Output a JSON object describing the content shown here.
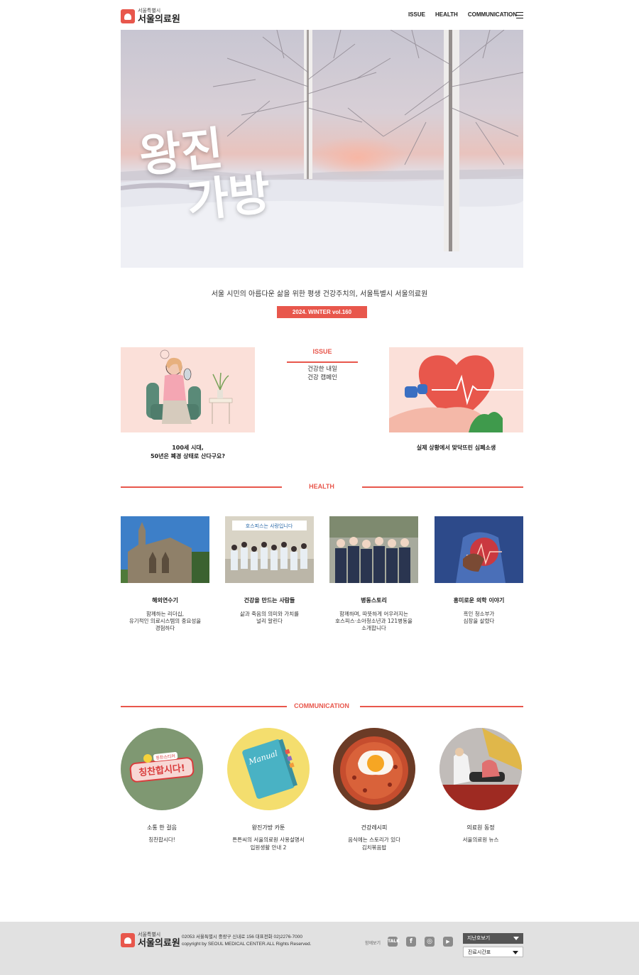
{
  "header": {
    "logo_small": "서울특별시",
    "logo_big": "서울의료원",
    "logo_badge": "서울특별시",
    "nav": [
      "ISSUE",
      "HEALTH",
      "COMMUNICATION"
    ]
  },
  "hero": {
    "title_line1": "왕진",
    "title_line2": "가방"
  },
  "intro": {
    "tagline": "서울 시민의 아름다운 삶을 위한 평생 건강주치의, 서울특별시 서울의료원",
    "volume": "2024. WINTER vol.160"
  },
  "issue": {
    "heading": "ISSUE",
    "sub_line1": "건강한 내일",
    "sub_line2": "건강 캠페인",
    "left_caption_line1": "100세 시대,",
    "left_caption_line2": "50년은 폐경 상태로 산다구요?",
    "right_caption": "실제 상황에서 맞닥뜨린 심폐소생"
  },
  "health": {
    "heading": "HEALTH",
    "items": [
      {
        "title": "해외연수기",
        "desc1": "함께하는 리더십,",
        "desc2": "유기적인 의료시스템의 중요성을",
        "desc3": "경험하다"
      },
      {
        "title": "건강을 만드는 사람들",
        "desc1": "삶과 죽음의 의미와 가치를",
        "desc2": "널리 알린다",
        "desc3": "",
        "banner": "호스피스는 사랑입니다"
      },
      {
        "title": "병동스토리",
        "desc1": "함께하며, 따뜻하게 어우러지는",
        "desc2": "호스피스·소아청소년과 121병동을",
        "desc3": "소개합니다"
      },
      {
        "title": "흥미로운 의학 이야기",
        "desc1": "흑인 청소부가",
        "desc2": "심장을 살렸다",
        "desc3": ""
      }
    ]
  },
  "communication": {
    "heading": "COMMUNICATION",
    "sticker_top": "칭찬스티커",
    "sticker_main": "칭찬합시다!",
    "manual_text": "Manual",
    "items": [
      {
        "title": "소통 한 걸음",
        "desc1": "칭찬합시다!",
        "desc2": ""
      },
      {
        "title": "왕진가방 카툰",
        "desc1": "튼튼씨의 서울의료원 사용설명서",
        "desc2": "입원생활 안내 2"
      },
      {
        "title": "건강레시피",
        "desc1": "음식에는 스토리가 있다",
        "desc2": "김치볶음밥"
      },
      {
        "title": "의료원 동정",
        "desc1": "서울의료원 뉴스",
        "desc2": ""
      }
    ]
  },
  "footer": {
    "logo_small": "서울특별시",
    "logo_big": "서울의료원",
    "address": "02053 서울특별시 중랑구 신내로 156 대표전화 02)2276-7000",
    "copyright": "copyright by SEOUL MEDICAL CENTER.ALL Rights Reserved.",
    "share_label": "함께보기",
    "sns": [
      "TALK",
      "f",
      "◎",
      "▶"
    ],
    "select1": "지난호보기",
    "select2": "진료시간표"
  },
  "colors": {
    "accent": "#e8574c",
    "card_bg": "#fbe0d9",
    "footer_bg": "#e1e1e1"
  }
}
